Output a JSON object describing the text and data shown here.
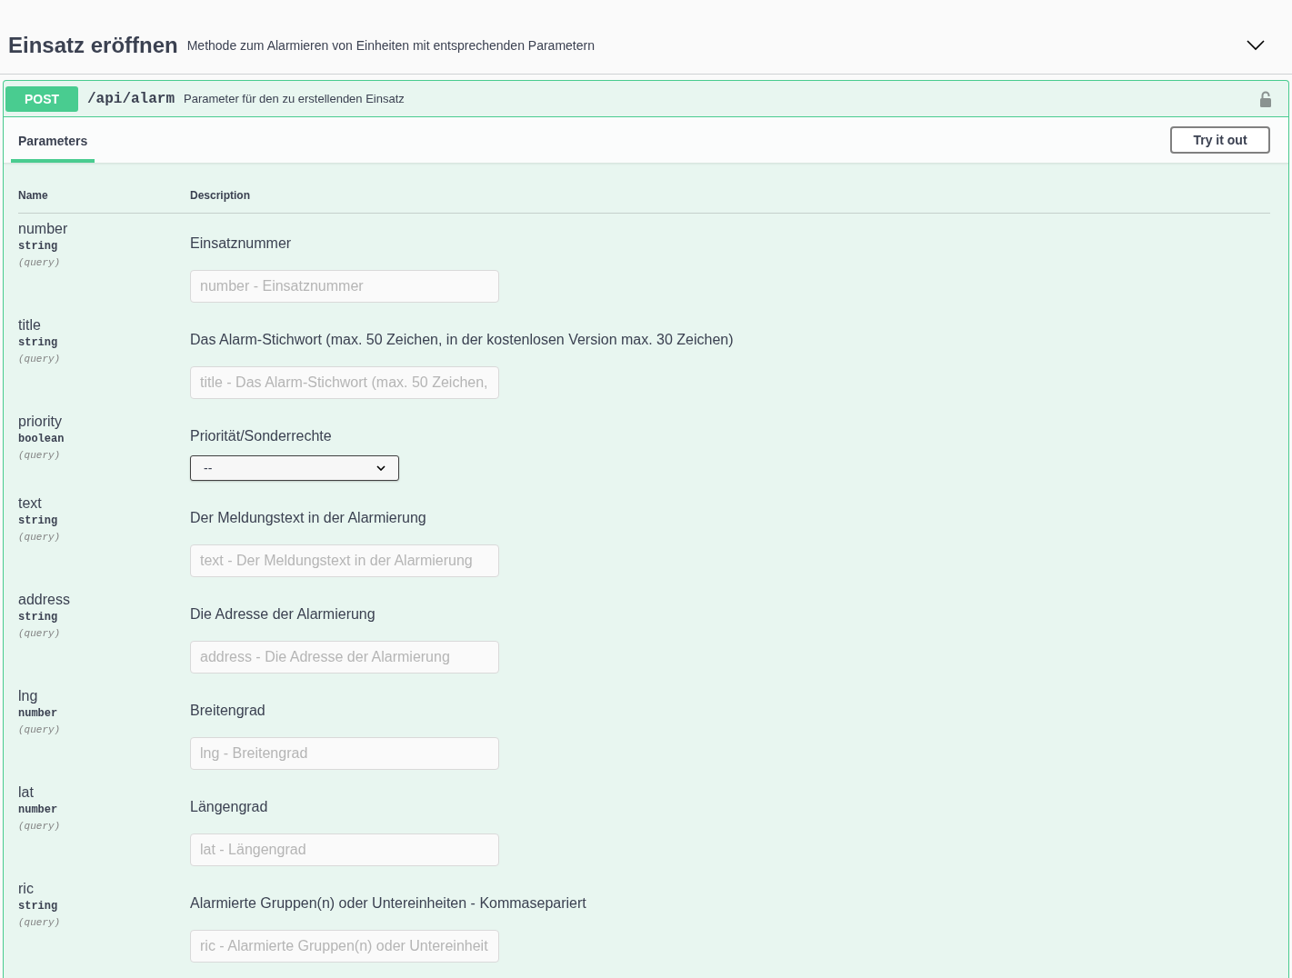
{
  "section": {
    "title": "Einsatz eröffnen",
    "description": "Methode zum Alarmieren von Einheiten mit entsprechenden Parametern",
    "expanded": true
  },
  "operation": {
    "method": "POST",
    "path": "/api/alarm",
    "summary": "Parameter für den zu erstellenden Einsatz"
  },
  "tabs": [
    {
      "label": "Parameters",
      "selected": true
    }
  ],
  "try_button": "Try it out",
  "table": {
    "columns": [
      "Name",
      "Description"
    ],
    "rows": [
      {
        "name": "number",
        "type": "string",
        "location": "(query)",
        "description": "Einsatznummer",
        "kind": "input",
        "placeholder": "number - Einsatznummer"
      },
      {
        "name": "title",
        "type": "string",
        "location": "(query)",
        "description": "Das Alarm-Stichwort (max. 50 Zeichen, in der kostenlosen Version max. 30 Zeichen)",
        "kind": "input",
        "placeholder": "title - Das Alarm-Stichwort (max. 50 Zeichen,"
      },
      {
        "name": "priority",
        "type": "boolean",
        "location": "(query)",
        "description": "Priorität/Sonderrechte",
        "kind": "select",
        "value": "--"
      },
      {
        "name": "text",
        "type": "string",
        "location": "(query)",
        "description": "Der Meldungstext in der Alarmierung",
        "kind": "input",
        "placeholder": "text - Der Meldungstext in der Alarmierung"
      },
      {
        "name": "address",
        "type": "string",
        "location": "(query)",
        "description": "Die Adresse der Alarmierung",
        "kind": "input",
        "placeholder": "address - Die Adresse der Alarmierung"
      },
      {
        "name": "lng",
        "type": "number",
        "location": "(query)",
        "description": "Breitengrad",
        "kind": "input",
        "placeholder": "lng - Breitengrad"
      },
      {
        "name": "lat",
        "type": "number",
        "location": "(query)",
        "description": "Längengrad",
        "kind": "input",
        "placeholder": "lat - Längengrad"
      },
      {
        "name": "ric",
        "type": "string",
        "location": "(query)",
        "description": "Alarmierte Gruppen(n) oder Untereinheiten - Kommasepariert",
        "kind": "input",
        "placeholder": "ric - Alarmierte Gruppen(n) oder Untereinheit"
      }
    ]
  }
}
